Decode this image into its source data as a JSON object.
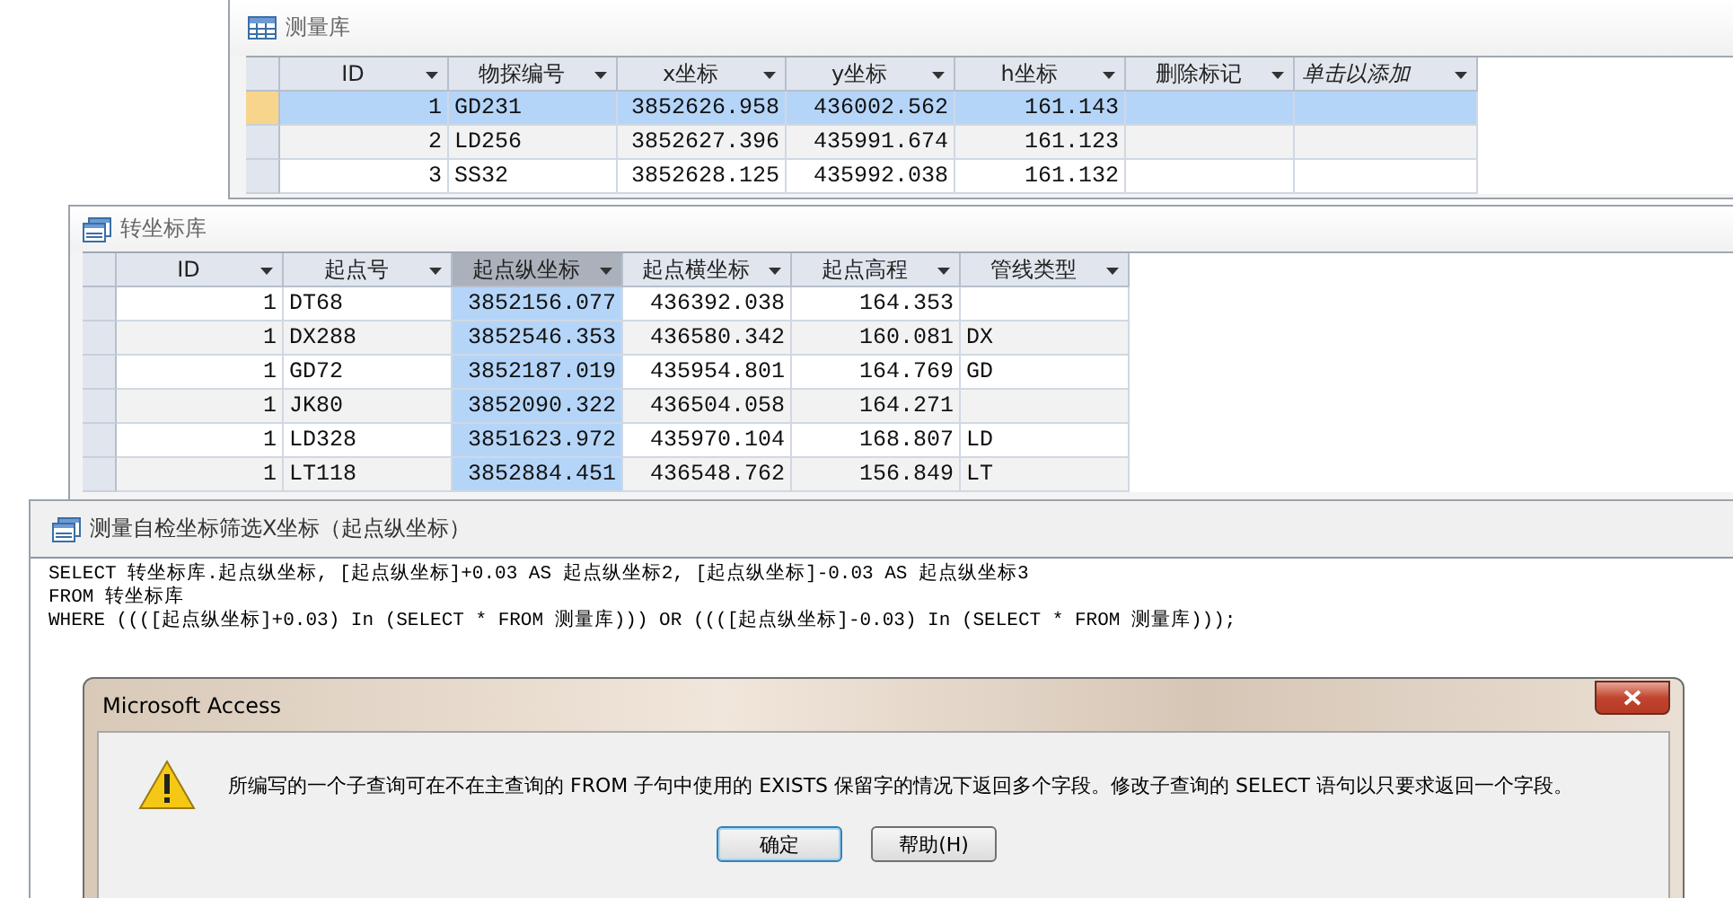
{
  "survey_table": {
    "title": "测量库",
    "columns": [
      {
        "label": "ID",
        "kind": "number",
        "selected": false
      },
      {
        "label": "物探编号",
        "kind": "text",
        "selected": false
      },
      {
        "label": "x坐标",
        "kind": "number",
        "selected": false
      },
      {
        "label": "y坐标",
        "kind": "number",
        "selected": false
      },
      {
        "label": "h坐标",
        "kind": "number",
        "selected": false
      },
      {
        "label": "删除标记",
        "kind": "text",
        "selected": false
      },
      {
        "label": "单击以添加",
        "kind": "add",
        "selected": false
      }
    ],
    "rows": [
      {
        "selected": true,
        "cells": [
          "1",
          "GD231",
          "3852626.958",
          "436002.562",
          "161.143",
          null,
          null
        ]
      },
      {
        "selected": false,
        "cells": [
          "2",
          "LD256",
          "3852627.396",
          "435991.674",
          "161.123",
          null,
          null
        ]
      },
      {
        "selected": false,
        "cells": [
          "3",
          "SS32",
          "3852628.125",
          "435992.038",
          "161.132",
          null,
          null
        ]
      }
    ]
  },
  "transform_table": {
    "title": "转坐标库",
    "columns": [
      {
        "label": "ID",
        "kind": "number",
        "selected": false
      },
      {
        "label": "起点号",
        "kind": "text",
        "selected": false
      },
      {
        "label": "起点纵坐标",
        "kind": "number",
        "selected": true
      },
      {
        "label": "起点横坐标",
        "kind": "number",
        "selected": false
      },
      {
        "label": "起点高程",
        "kind": "number",
        "selected": false
      },
      {
        "label": "管线类型",
        "kind": "text",
        "selected": false
      }
    ],
    "rows": [
      {
        "selected": false,
        "cells": [
          "1",
          "DT68",
          "3852156.077",
          "436392.038",
          "164.353",
          null
        ]
      },
      {
        "selected": false,
        "cells": [
          "1",
          "DX288",
          "3852546.353",
          "436580.342",
          "160.081",
          "DX"
        ]
      },
      {
        "selected": false,
        "cells": [
          "1",
          "GD72",
          "3852187.019",
          "435954.801",
          "164.769",
          "GD"
        ]
      },
      {
        "selected": false,
        "cells": [
          "1",
          "JK80",
          "3852090.322",
          "436504.058",
          "164.271",
          null
        ]
      },
      {
        "selected": false,
        "cells": [
          "1",
          "LD328",
          "3851623.972",
          "435970.104",
          "168.807",
          "LD"
        ]
      },
      {
        "selected": false,
        "cells": [
          "1",
          "LT118",
          "3852884.451",
          "436548.762",
          "156.849",
          "LT"
        ]
      }
    ]
  },
  "query_window": {
    "title": "测量自检坐标筛选X坐标（起点纵坐标）",
    "sql_lines": [
      "SELECT 转坐标库.起点纵坐标, [起点纵坐标]+0.03 AS 起点纵坐标2, [起点纵坐标]-0.03 AS 起点纵坐标3",
      "FROM 转坐标库",
      "WHERE ((([起点纵坐标]+0.03) In (SELECT * FROM 测量库))) OR ((([起点纵坐标]-0.03) In (SELECT * FROM 测量库)));"
    ]
  },
  "dialog": {
    "title": "Microsoft Access",
    "message": "所编写的一个子查询可在不在主查询的 FROM 子句中使用的 EXISTS 保留字的情况下返回多个字段。修改子查询的 SELECT 语句以只要求返回一个字段。",
    "buttons": [
      {
        "label": "确定",
        "selected": true
      },
      {
        "label": "帮助(H)",
        "selected": false
      }
    ]
  }
}
